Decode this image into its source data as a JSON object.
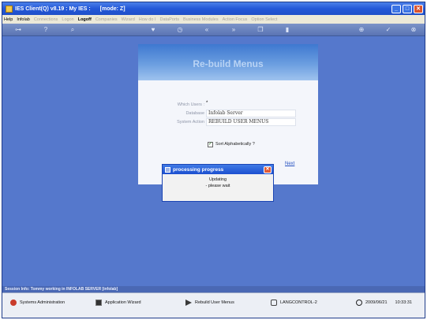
{
  "window": {
    "title_parts": [
      "IES Client(Q) v8.19 : My IES :",
      "[mode: Z]"
    ]
  },
  "menu": [
    {
      "label": "Help",
      "enabled": true
    },
    {
      "label": "Infolab",
      "enabled": true
    },
    {
      "label": "Connections",
      "enabled": false
    },
    {
      "label": "Logon",
      "enabled": false
    },
    {
      "label": "Logoff",
      "enabled": true
    },
    {
      "label": "Companies",
      "enabled": false
    },
    {
      "label": "Wizard",
      "enabled": false
    },
    {
      "label": "How do I",
      "enabled": false
    },
    {
      "label": "DataPorts",
      "enabled": false
    },
    {
      "label": "Business Modules",
      "enabled": false
    },
    {
      "label": "Action Focus",
      "enabled": false
    },
    {
      "label": "Option Select",
      "enabled": false
    }
  ],
  "toolbar_icons": [
    "key-icon",
    "help-icon",
    "search-icon",
    "heart-icon",
    "clock-icon",
    "back-icon",
    "forward-icon",
    "copy-icon",
    "page-icon",
    "add-icon",
    "check-icon",
    "close-icon"
  ],
  "form": {
    "title": "Re-build Menus",
    "which_users_label": "Which Users :",
    "which_users_value": "*",
    "database_label": "Database",
    "database_value": "Infolab Server",
    "system_action_label": "System Action",
    "system_action_value": "REBUILD USER MENUS",
    "sort_label": "Sort Alphabetically ?",
    "sort_checked": true,
    "next_label": "Next"
  },
  "dialog": {
    "title": "processing progress",
    "line1": "Updating",
    "line2": "- please wait"
  },
  "session_info": "Session Info: Tommy working in INFOLAB SERVER  [infolab]",
  "taskbar": {
    "items": [
      "Systems Administration",
      "Application Wizard",
      "Rebuild User Menus",
      "LANGCONTROL-2"
    ],
    "date": "2009/06/21",
    "time": "10:33:31"
  }
}
